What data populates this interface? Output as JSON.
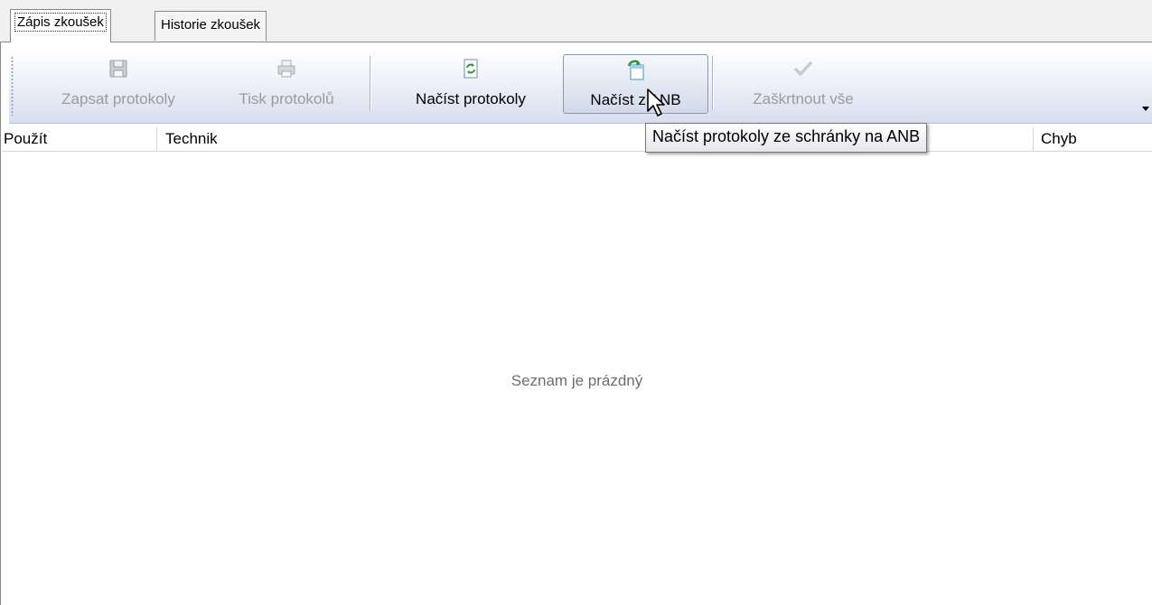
{
  "tabs": [
    {
      "label": "Zápis zkoušek",
      "active": true
    },
    {
      "label": "Historie zkoušek",
      "active": false
    }
  ],
  "toolbar": {
    "buttons": [
      {
        "label": "Zapsat protokoly",
        "icon": "save-icon",
        "enabled": false
      },
      {
        "label": "Tisk protokolů",
        "icon": "printer-icon",
        "enabled": false
      },
      {
        "label": "Načíst protokoly",
        "icon": "refresh-document-icon",
        "enabled": true
      },
      {
        "label": "Načíst z ANB",
        "icon": "import-document-icon",
        "enabled": true,
        "state": "hover"
      },
      {
        "label": "Zaškrtnout vše",
        "icon": "checkmark-icon",
        "enabled": false
      }
    ],
    "overflow_icon": "dropdown-arrow-icon"
  },
  "table": {
    "columns": [
      "Použít",
      "Technik",
      "Chyb"
    ],
    "empty_text": "Seznam je prázdný"
  },
  "tooltip": {
    "text": "Načíst protokoly ze schránky na ANB"
  },
  "colors": {
    "toolbar_top": "#ffffff",
    "toolbar_bottom": "#d8def0",
    "disabled_text": "#9b9b9b",
    "accent_green": "#2e9a3a"
  }
}
